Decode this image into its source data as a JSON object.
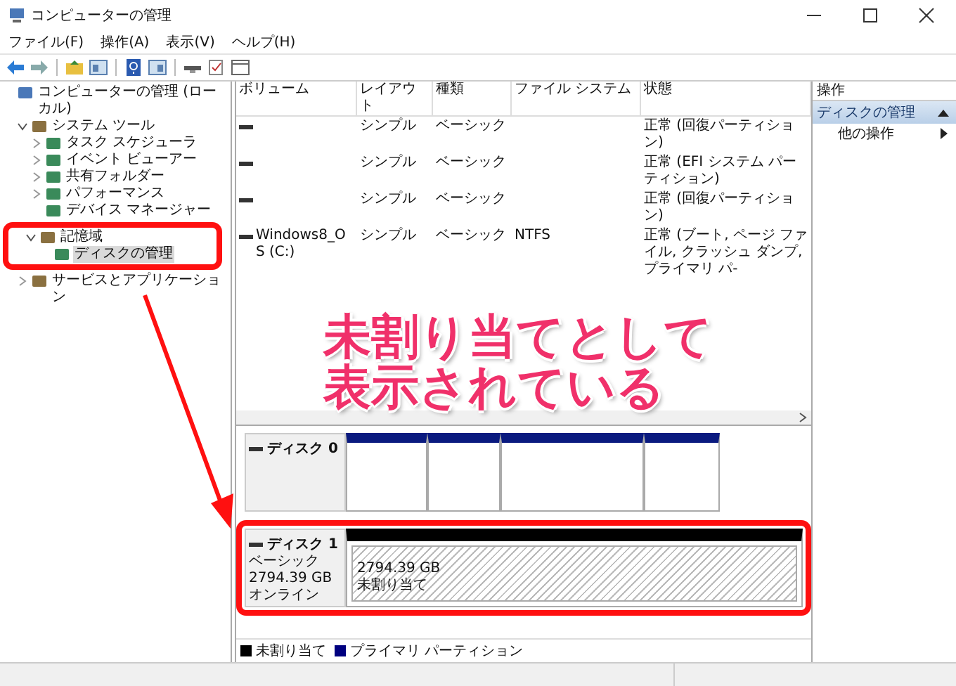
{
  "window": {
    "title": "コンピューターの管理"
  },
  "menu": [
    "ファイル(F)",
    "操作(A)",
    "表示(V)",
    "ヘルプ(H)"
  ],
  "tree": [
    {
      "label": "コンピューターの管理 (ローカル)",
      "selected": false,
      "children": [
        {
          "label": "システム ツール",
          "expanded": true,
          "selected": false,
          "children": [
            {
              "label": "タスク スケジューラ",
              "expanded": false,
              "selected": false
            },
            {
              "label": "イベント ビューアー",
              "expanded": false,
              "selected": false
            },
            {
              "label": "共有フォルダー",
              "expanded": false,
              "selected": false
            },
            {
              "label": "パフォーマンス",
              "expanded": false,
              "selected": false
            },
            {
              "label": "デバイス マネージャー",
              "selected": false
            }
          ]
        },
        {
          "label": "記憶域",
          "expanded": true,
          "selected": false,
          "highlighted": true,
          "children": [
            {
              "label": "ディスクの管理",
              "selected": true
            }
          ]
        },
        {
          "label": "サービスとアプリケーション",
          "expanded": false,
          "selected": false
        }
      ]
    }
  ],
  "volumes": {
    "columns": [
      "ボリューム",
      "レイアウト",
      "種類",
      "ファイル システム",
      "状態"
    ],
    "rows": [
      [
        "",
        "シンプル",
        "ベーシック",
        "",
        "正常 (回復パーティション)"
      ],
      [
        "",
        "シンプル",
        "ベーシック",
        "",
        "正常 (EFI システム パーティション)"
      ],
      [
        "",
        "シンプル",
        "ベーシック",
        "",
        "正常 (回復パーティション)"
      ],
      [
        "Windows8_OS (C:)",
        "シンプル",
        "ベーシック",
        "NTFS",
        "正常 (ブート, ページ ファイル, クラッシュ ダンプ, プライマリ パ-"
      ]
    ]
  },
  "disks": [
    {
      "name": "ディスク 0",
      "highlighted": false,
      "partitions": [
        {
          "kind": "primary"
        },
        {
          "kind": "primary"
        },
        {
          "kind": "primary"
        },
        {
          "kind": "primary"
        }
      ]
    },
    {
      "name": "ディスク 1",
      "type": "ベーシック",
      "size": "2794.39 GB",
      "status": "オンライン",
      "highlighted": true,
      "partitions": [
        {
          "kind": "unallocated",
          "size": "2794.39 GB",
          "label": "未割り当て"
        }
      ]
    }
  ],
  "legend": [
    {
      "label": "未割り当て",
      "color": "#000000"
    },
    {
      "label": "プライマリ パーティション",
      "color": "#00007f"
    }
  ],
  "actions": {
    "header": "操作",
    "section": "ディスクの管理",
    "items": [
      "他の操作"
    ]
  },
  "callout": {
    "lines": [
      "未割り当てとして",
      "表示されている"
    ]
  }
}
